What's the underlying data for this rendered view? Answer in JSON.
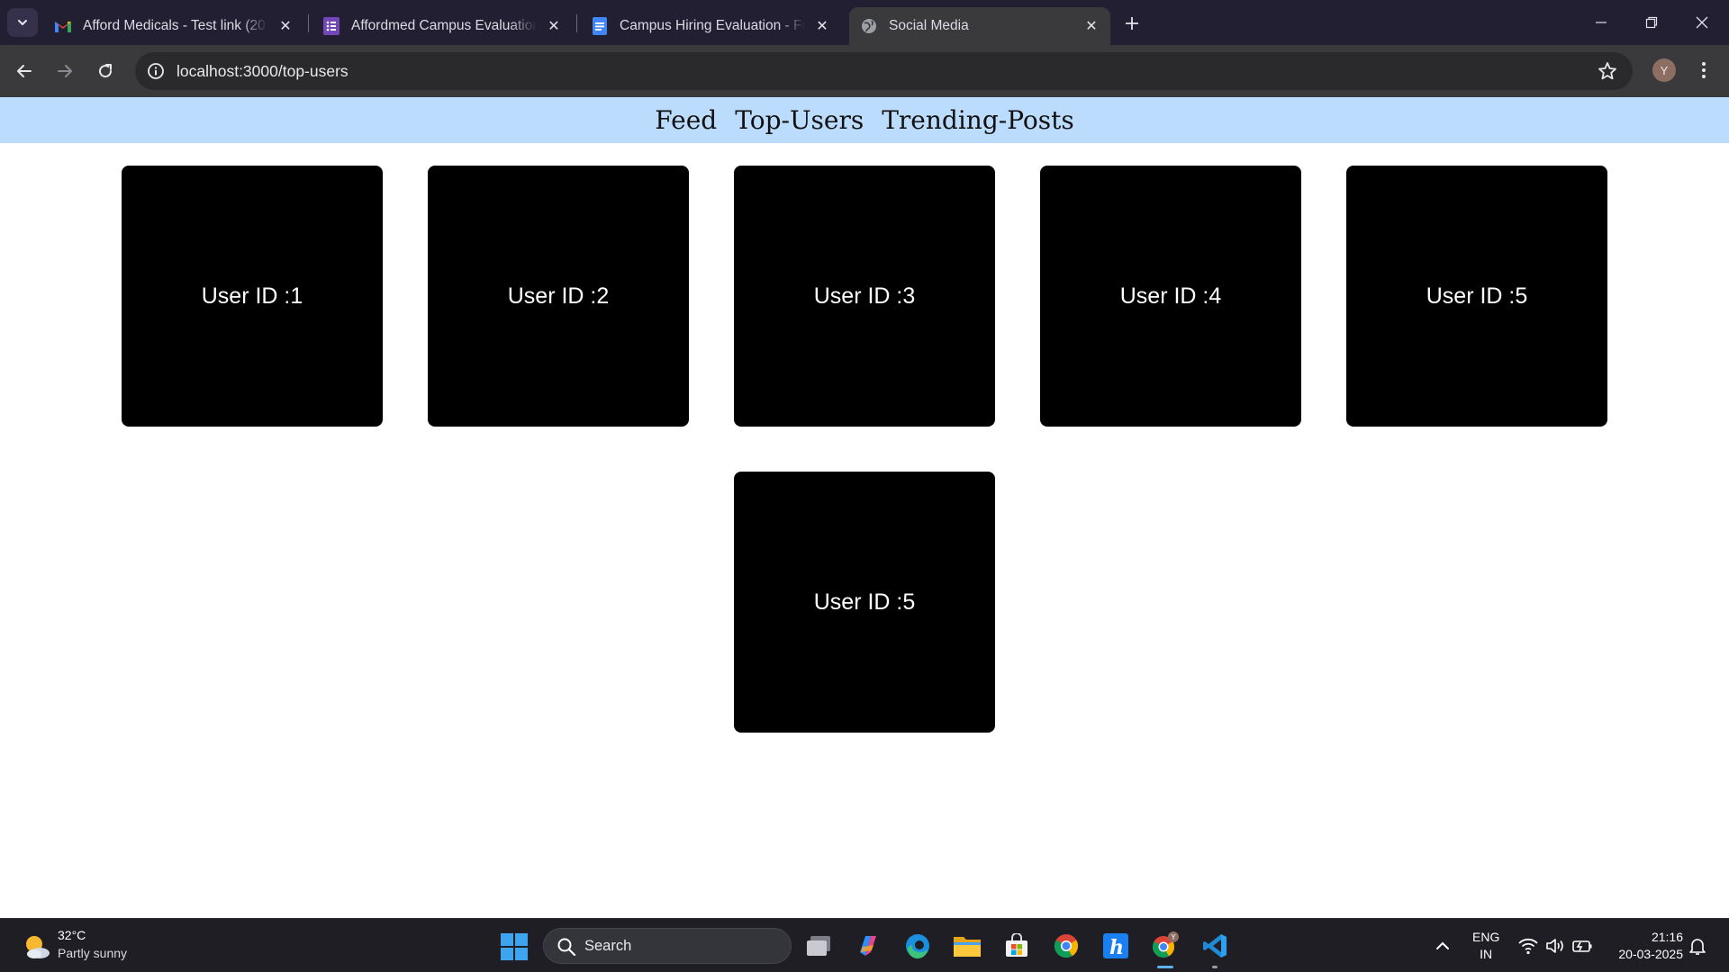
{
  "browser": {
    "tabs": [
      {
        "title": "Afford Medicals - Test link (20.0",
        "favicon": "gmail-icon"
      },
      {
        "title": "Affordmed Campus Evaluation |",
        "favicon": "forms-icon"
      },
      {
        "title": "Campus Hiring Evaluation - Full",
        "favicon": "docs-icon"
      },
      {
        "title": "Social Media",
        "favicon": "globe-icon",
        "active": true
      }
    ],
    "url": "localhost:3000/top-users",
    "profile_initial": "Y"
  },
  "site": {
    "nav": [
      "Feed",
      "Top-Users",
      "Trending-Posts"
    ],
    "users": [
      {
        "label": "User ID :1"
      },
      {
        "label": "User ID :2"
      },
      {
        "label": "User ID :3"
      },
      {
        "label": "User ID :4"
      },
      {
        "label": "User ID :5"
      },
      {
        "label": "User ID :5"
      }
    ]
  },
  "taskbar": {
    "weather": {
      "temp": "32°C",
      "desc": "Partly sunny"
    },
    "search_label": "Search",
    "lang": {
      "line1": "ENG",
      "line2": "IN"
    },
    "clock": {
      "time": "21:16",
      "date": "20-03-2025"
    }
  },
  "colors": {
    "nav_bar_bg": "#bcdcfd",
    "card_bg": "#000000",
    "card_text": "#ffffff",
    "tabstrip_bg": "#231f33",
    "toolbar_bg": "#3a3a3d"
  }
}
